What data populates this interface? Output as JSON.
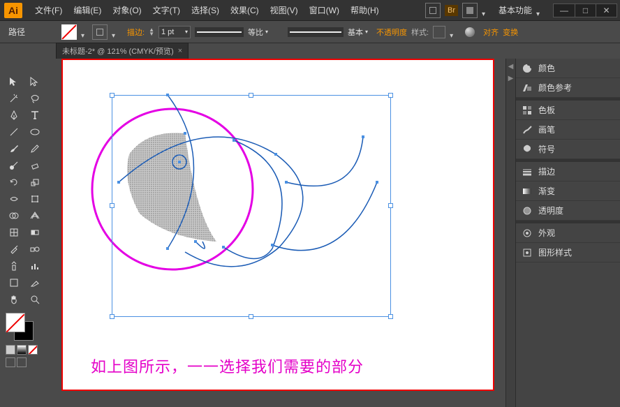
{
  "app": {
    "logo": "Ai"
  },
  "menu": [
    "文件(F)",
    "编辑(E)",
    "对象(O)",
    "文字(T)",
    "选择(S)",
    "效果(C)",
    "视图(V)",
    "窗口(W)",
    "帮助(H)"
  ],
  "title_right": {
    "search": "▭",
    "br": "Br",
    "layout": "▦",
    "workspace": "基本功能"
  },
  "winbtns": [
    "—",
    "□",
    "✕"
  ],
  "toolbar": {
    "path_label": "路径",
    "stroke_label": "描边:",
    "stroke_pt": "1 pt",
    "ratio_label": "等比",
    "variable_label": "基本",
    "opacity_label": "不透明度",
    "style_label": "样式:",
    "align_label": "对齐",
    "transform_label": "变换"
  },
  "tab": {
    "label": "未标题-2* @ 121% (CMYK/预览)",
    "close": "×"
  },
  "canvas": {
    "caption": "如上图所示，一一选择我们需要的部分"
  },
  "panels": {
    "color": "颜色",
    "color_guide": "颜色参考",
    "swatches": "色板",
    "brushes": "画笔",
    "symbols": "符号",
    "stroke": "描边",
    "gradient": "渐变",
    "transparency": "透明度",
    "appearance": "外观",
    "graphic_styles": "图形样式"
  }
}
